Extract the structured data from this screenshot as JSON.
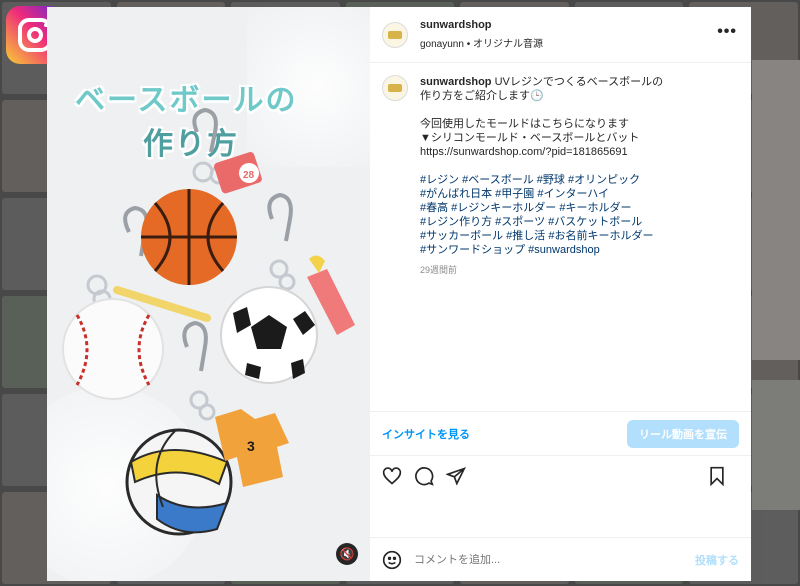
{
  "post": {
    "username": "sunwardshop",
    "audio": "gonayunn • オリジナル音源",
    "more_label": "•••",
    "image_title_line1": "ベースボールの",
    "image_title_line2": "作り方",
    "caption_intro": "UVレジンでつくるベースボールの",
    "caption_intro2": "作り方をご紹介します🕒",
    "caption_line3": "今回使用したモールドはこちらになります",
    "caption_line4": "▼シリコンモールド・ベースボールとバット",
    "caption_url": "https://sunwardshop.com/?pid=181865691",
    "hashtags": [
      "#レジン #ベースボール #野球 #オリンピック",
      "#がんばれ日本 #甲子園 #インターハイ",
      "#春高 #レジンキーホルダー #キーホルダー",
      "#レジン作り方 #スポーツ #バスケットボール",
      "#サッカーボール #推し活 #お名前キーホルダー",
      "#サンワードショップ #sunwardshop"
    ],
    "time_ago": "29週間前",
    "insights_label": "インサイトを見る",
    "promote_label": "リール動画を宣伝",
    "comment_placeholder": "コメントを追加...",
    "post_label": "投稿する",
    "mute_icon_glyph": "🔇"
  },
  "colors": {
    "accent": "#0095f6",
    "promote_bg": "#b2dffc",
    "hashtag": "#00376b",
    "title_teal": "#6ec9c8"
  },
  "icons": [
    "instagram-logo-icon",
    "more-options-icon",
    "heart-icon",
    "comment-icon",
    "share-icon",
    "bookmark-icon",
    "emoji-icon",
    "mute-icon"
  ]
}
